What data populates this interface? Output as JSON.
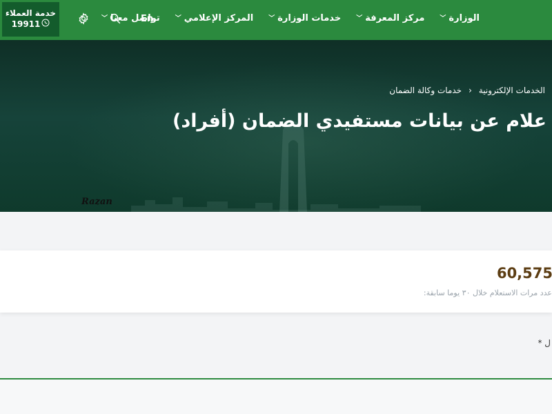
{
  "header": {
    "customer_service": {
      "title": "خدمة العملاء",
      "number": "19911"
    },
    "language": "En",
    "nav": [
      {
        "label": "الوزارة"
      },
      {
        "label": "مركز المعرفة"
      },
      {
        "label": "خدمات الوزارة"
      },
      {
        "label": "المركز الإعلامي"
      },
      {
        "label": "تواصل معنا"
      }
    ],
    "icons": [
      "gear-icon",
      "search-icon",
      "phone-icon",
      "chevron-down-icon"
    ]
  },
  "hero": {
    "breadcrumb": [
      "الخدمات الإلكترونية",
      "›",
      "خدمات وكالة الضمان"
    ],
    "title": "علام عن بيانات مستفيدي الضمان (أفراد)",
    "watermark": "Razan"
  },
  "stats": {
    "count": "60,575",
    "label": "عدد مرات الاستعلام خلال ٣٠ يوما سابقة:"
  },
  "form": {
    "required_marker": "ل *"
  },
  "colors": {
    "primary_green": "#2b8a3e",
    "dark_green": "#135c2c",
    "count_brown": "#5c3d13"
  }
}
